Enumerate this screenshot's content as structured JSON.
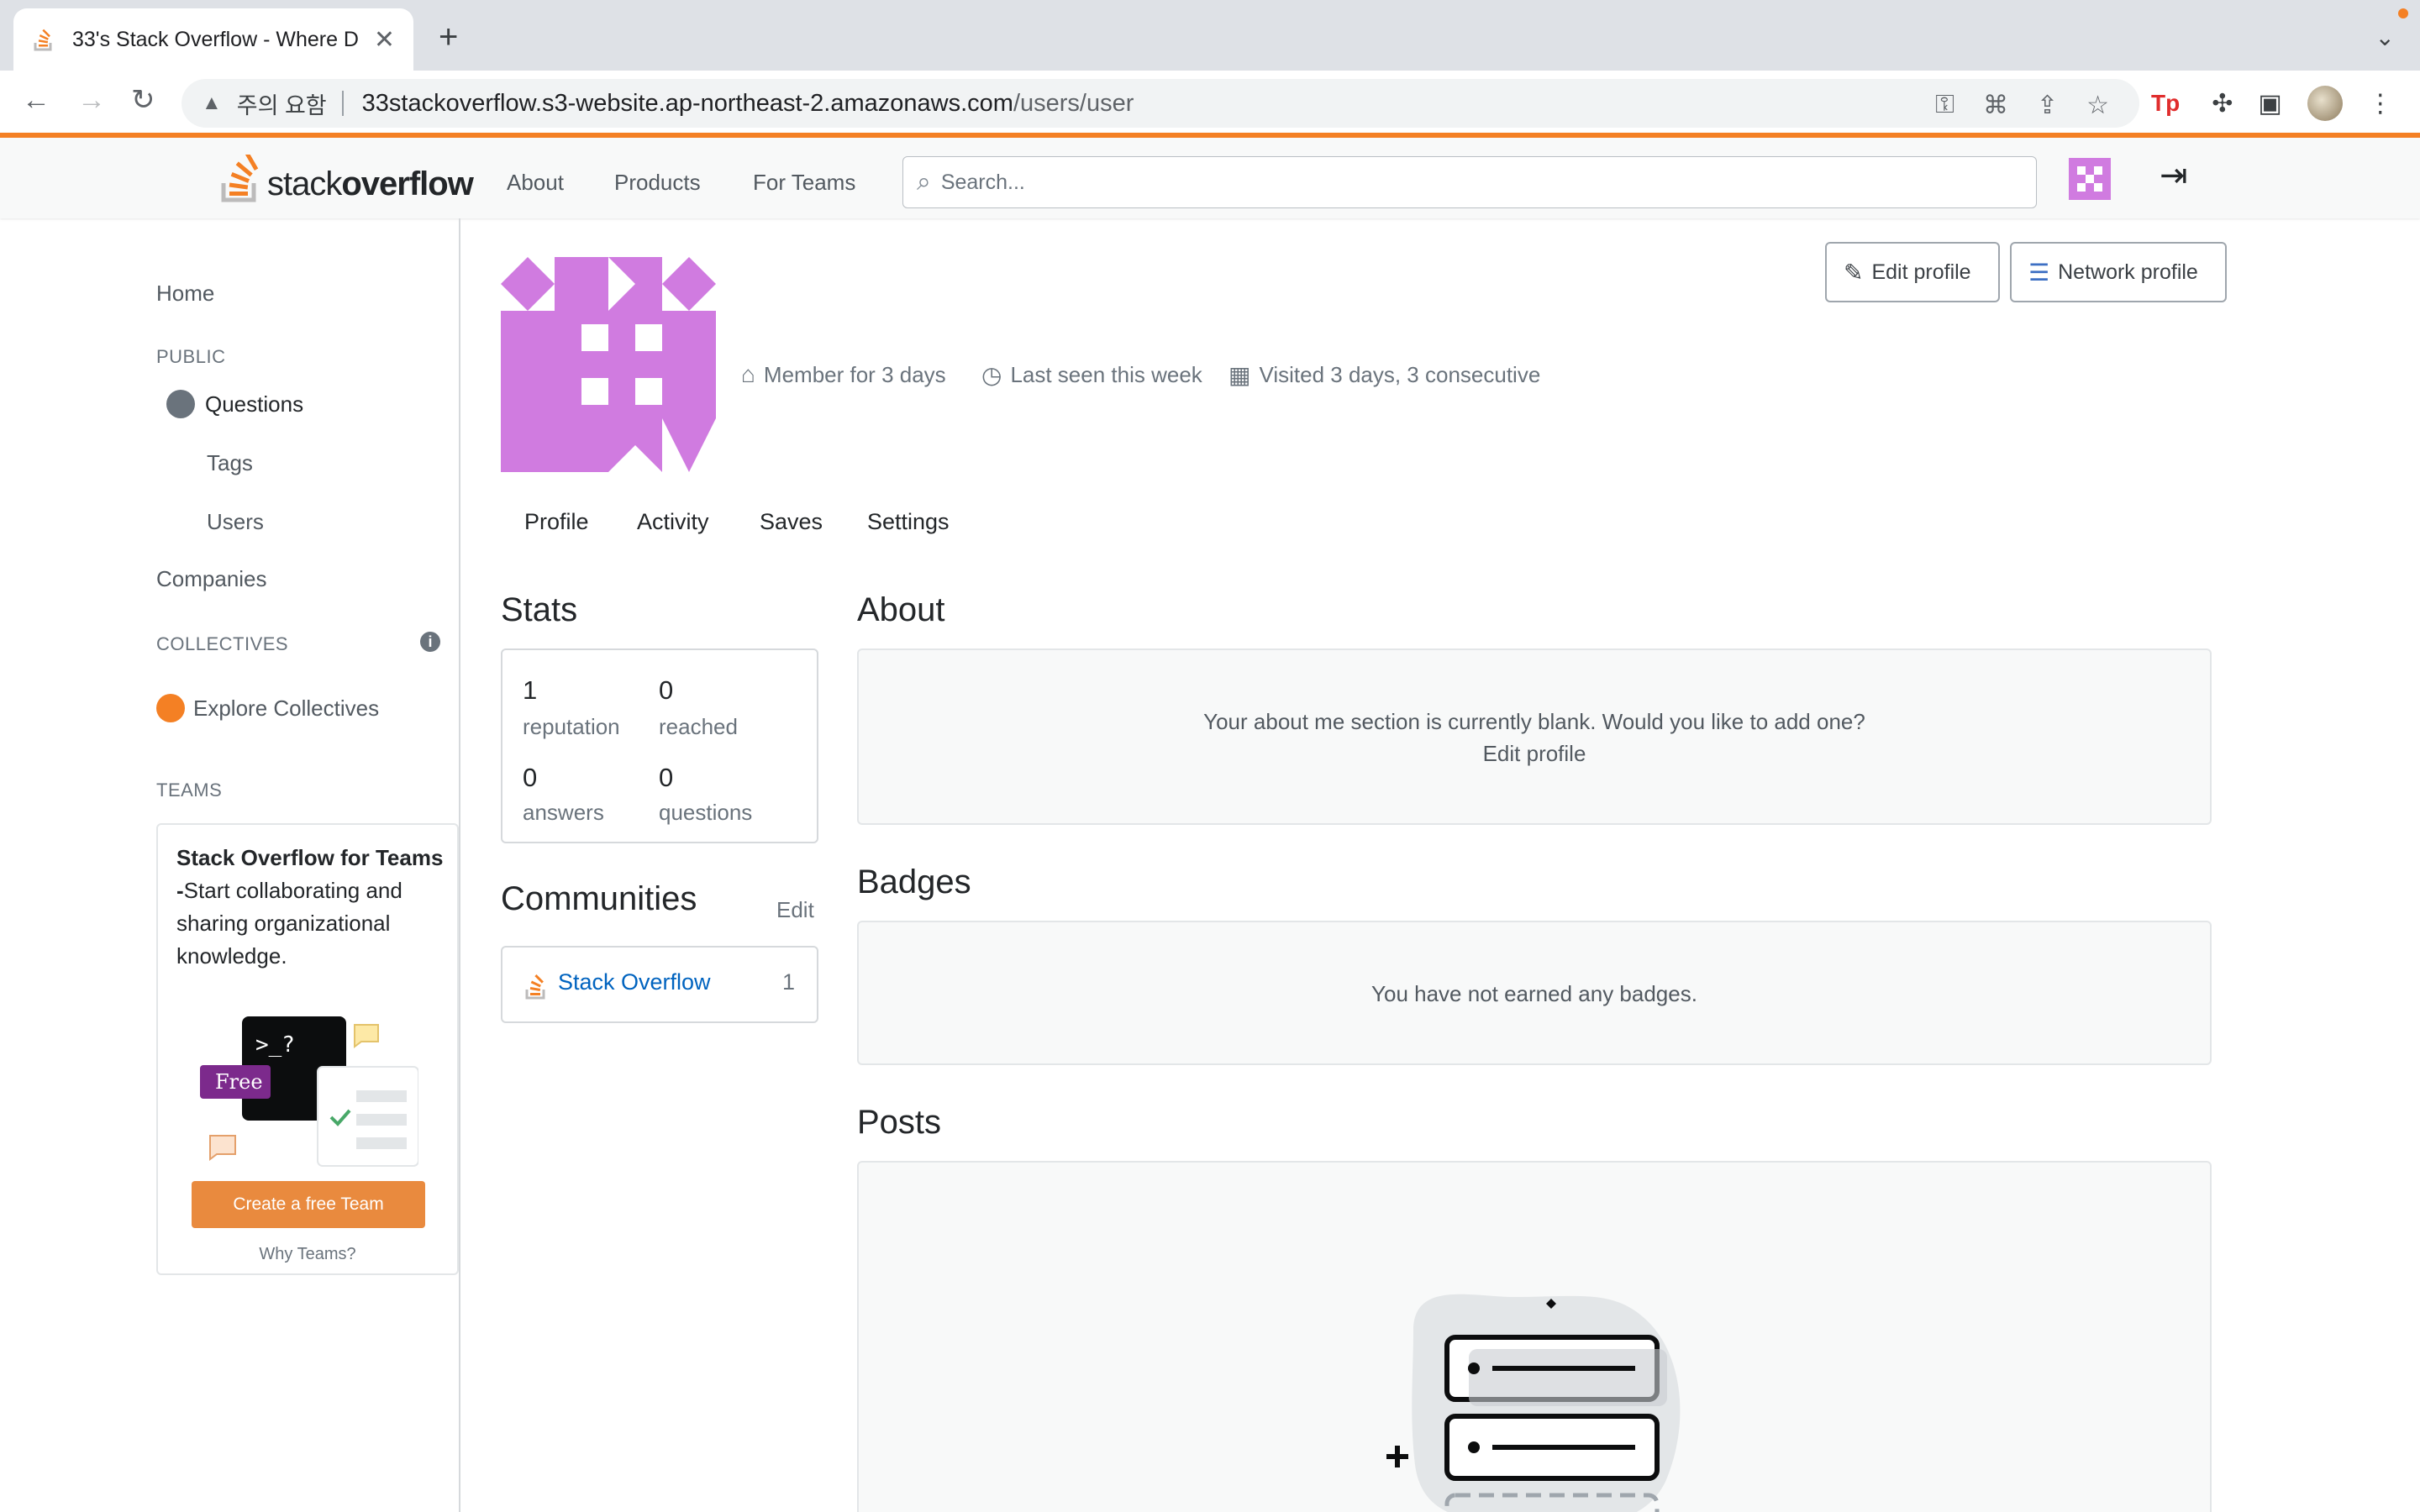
{
  "browser": {
    "tab_title": "33's Stack Overflow - Where D",
    "new_tab_symbol": "+",
    "security_warning": "주의 요함",
    "url_host": "33stackoverflow.s3-website.ap-northeast-2.amazonaws.com",
    "url_path": "/users/user"
  },
  "topbar": {
    "logo_light": "stack",
    "logo_bold": "overflow",
    "nav": [
      "About",
      "Products",
      "For Teams"
    ],
    "search_placeholder": "Search..."
  },
  "sidebar": {
    "home": "Home",
    "public_heading": "PUBLIC",
    "questions": "Questions",
    "tags": "Tags",
    "users": "Users",
    "companies": "Companies",
    "collectives_heading": "COLLECTIVES",
    "explore_collectives": "Explore Collectives",
    "teams_heading": "TEAMS",
    "teams_card": {
      "title_bold": "Stack Overflow for Teams -",
      "title_rest": "Start collaborating and sharing organizational knowledge.",
      "free_badge": "Free",
      "terminal_text": ">_?",
      "create_button": "Create a free Team",
      "why_teams": "Why Teams?"
    }
  },
  "profile": {
    "member_for": "Member for 3 days",
    "last_seen": "Last seen this week",
    "visited": "Visited 3 days, 3 consecutive",
    "edit_profile": "Edit profile",
    "network_profile": "Network profile",
    "tabs": [
      "Profile",
      "Activity",
      "Saves",
      "Settings"
    ]
  },
  "stats": {
    "title": "Stats",
    "reputation": "1",
    "reputation_label": "reputation",
    "reached": "0",
    "reached_label": "reached",
    "answers": "0",
    "answers_label": "answers",
    "questions": "0",
    "questions_label": "questions"
  },
  "communities": {
    "title": "Communities",
    "edit": "Edit",
    "items": [
      {
        "name": "Stack Overflow",
        "reputation": "1"
      }
    ]
  },
  "about": {
    "title": "About",
    "blank_text": "Your about me section is currently blank. Would you like to add one?",
    "edit_link": "Edit profile"
  },
  "badges": {
    "title": "Badges",
    "empty_text": "You have not earned any badges."
  },
  "posts": {
    "title": "Posts"
  },
  "colors": {
    "brand_orange": "#f48024",
    "link_blue": "#0063bf",
    "identicon_purple": "#d07be0"
  }
}
